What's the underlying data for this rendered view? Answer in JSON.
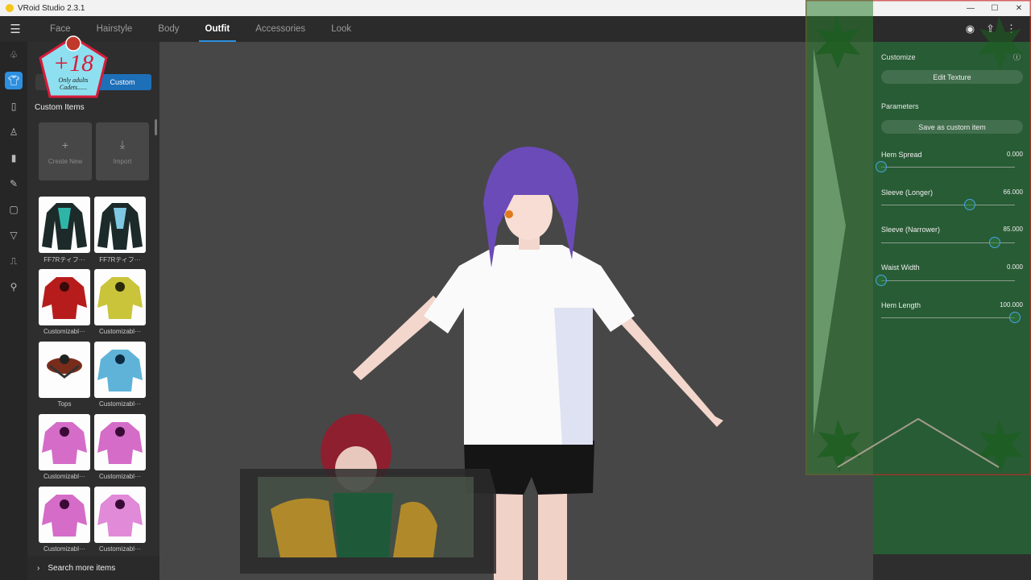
{
  "window": {
    "title": "VRoid Studio 2.3.1"
  },
  "nav": {
    "tabs": [
      "Face",
      "Hairstyle",
      "Body",
      "Outfit",
      "Accessories",
      "Look"
    ],
    "active_tab": "Outfit"
  },
  "left_panel": {
    "badge": {
      "big": "+18",
      "line1": "Only adults",
      "line2": "Cadets......"
    },
    "segment": {
      "custom_label": "Custom"
    },
    "section_title": "Custom Items",
    "actions": {
      "create_new": "Create New",
      "import": "Import"
    },
    "items": [
      {
        "label": "FF7Rティフ···"
      },
      {
        "label": "FF7Rティフ···"
      },
      {
        "label": "Customizabl···"
      },
      {
        "label": "Customizabl···"
      },
      {
        "label": "Tops"
      },
      {
        "label": "Customizabl···"
      },
      {
        "label": "Customizabl···"
      },
      {
        "label": "Customizabl···"
      },
      {
        "label": "Customizabl···"
      },
      {
        "label": "Customizabl···"
      }
    ],
    "search_more": "Search more items"
  },
  "right_panel": {
    "customize_title": "Customize",
    "edit_texture": "Edit Texture",
    "parameters_title": "Parameters",
    "save_custom": "Save as custom item",
    "sliders": [
      {
        "label": "Hem Spread",
        "value": "0.000",
        "fraction": 0.0
      },
      {
        "label": "Sleeve (Longer)",
        "value": "66.000",
        "fraction": 0.66
      },
      {
        "label": "Sleeve (Narrower)",
        "value": "85.000",
        "fraction": 0.85
      },
      {
        "label": "Waist Width",
        "value": "0.000",
        "fraction": 0.0
      },
      {
        "label": "Hem Length",
        "value": "100.000",
        "fraction": 1.0
      }
    ]
  },
  "colors": {
    "accent": "#2d8fe0",
    "overlay_green": "#2e7d32"
  }
}
